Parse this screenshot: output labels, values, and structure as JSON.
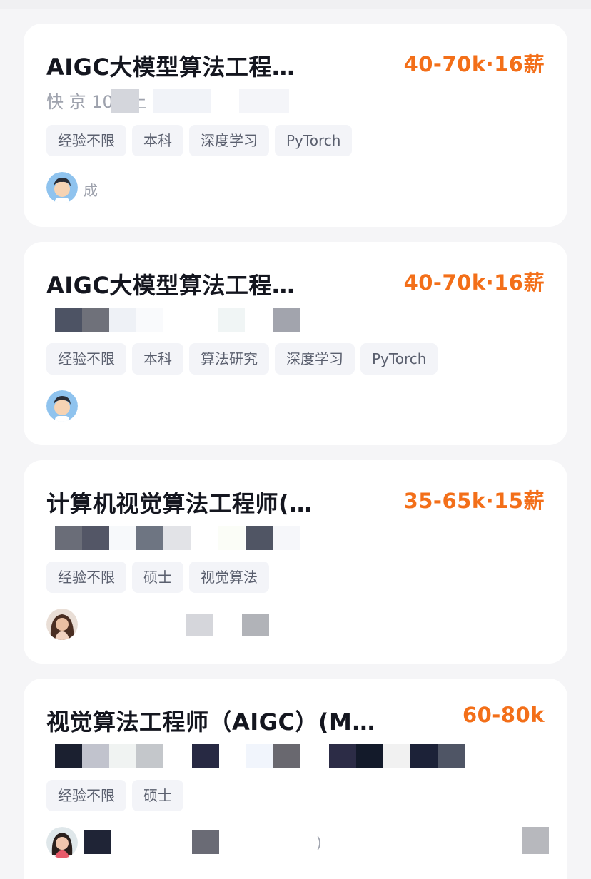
{
  "jobs": [
    {
      "title": "AIGC大模型算法工程…",
      "salary": "40-70k·16薪",
      "company": "快              京 100       上",
      "tags": [
        "经验不限",
        "本科",
        "深度学习",
        "PyTorch"
      ],
      "recruiter": "成",
      "avatar": "male-avatar-icon"
    },
    {
      "title": "AIGC大模型算法工程…",
      "salary": "40-70k·16薪",
      "company": "",
      "tags": [
        "经验不限",
        "本科",
        "算法研究",
        "深度学习",
        "PyTorch"
      ],
      "recruiter": "",
      "avatar": "male-avatar-icon"
    },
    {
      "title": "计算机视觉算法工程师(…",
      "salary": "35-65k·15薪",
      "company": "",
      "tags": [
        "经验不限",
        "硕士",
        "视觉算法"
      ],
      "recruiter": "",
      "avatar": "female-avatar-icon"
    },
    {
      "title": "视觉算法工程师（AIGC）(M…",
      "salary": "60-80k",
      "company": "",
      "tags": [
        "经验不限",
        "硕士"
      ],
      "recruiter": ")",
      "avatar": "female-avatar-icon"
    }
  ],
  "colors": {
    "salary": "#f36f19",
    "title": "#14161f",
    "tag_bg": "#f3f4f8"
  }
}
